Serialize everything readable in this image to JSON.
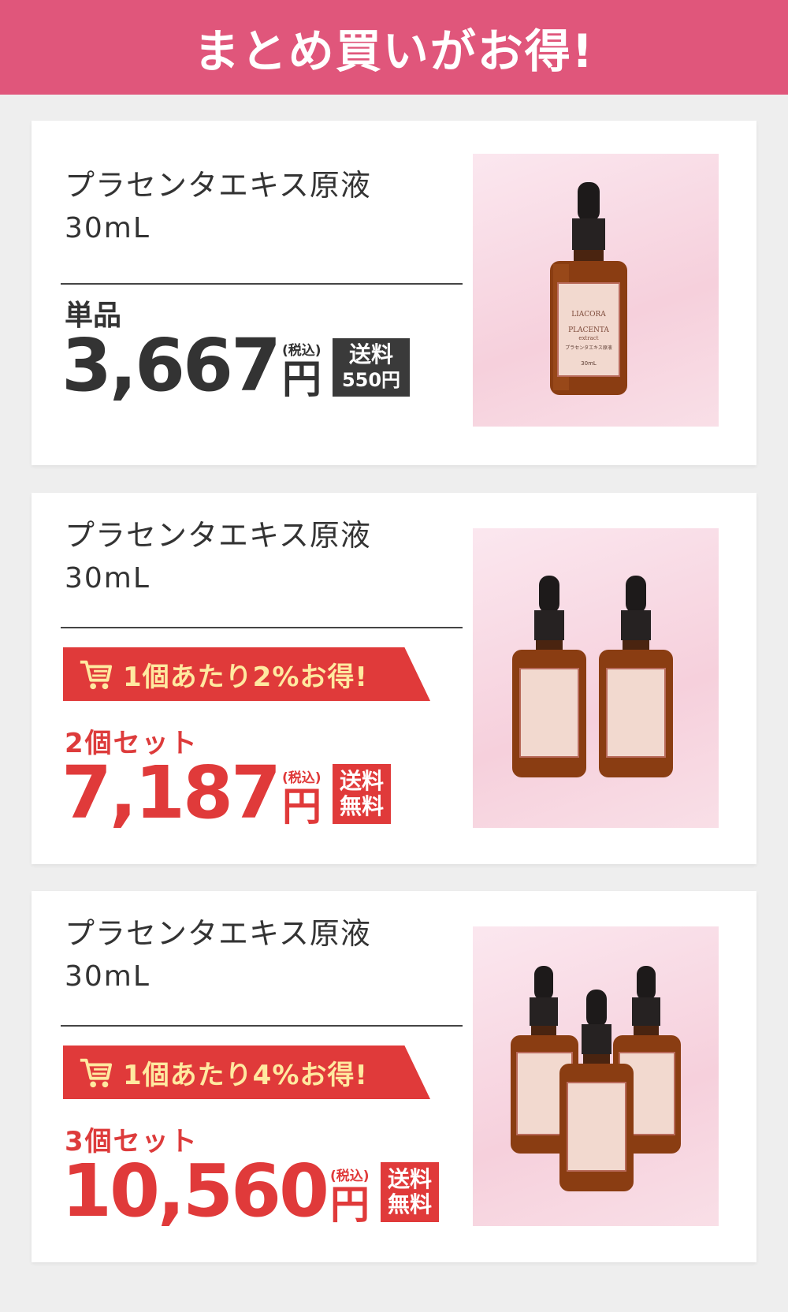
{
  "header": {
    "title": "まとめ買いがお得!"
  },
  "products": [
    {
      "name": "プラセンタエキス原液",
      "volume": "30mL",
      "label": "単品",
      "price": "3,667",
      "tax": "(税込)",
      "yen": "円",
      "shipping_line1": "送料",
      "shipping_line2": "550円"
    },
    {
      "name": "プラセンタエキス原液",
      "volume": "30mL",
      "ribbon": "1個あたり2%お得!",
      "label": "2個セット",
      "price": "7,187",
      "tax": "(税込)",
      "yen": "円",
      "shipping_line1": "送料",
      "shipping_line2": "無料"
    },
    {
      "name": "プラセンタエキス原液",
      "volume": "30mL",
      "ribbon": "1個あたり4%お得!",
      "label": "3個セット",
      "price": "10,560",
      "tax": "(税込)",
      "yen": "円",
      "shipping_line1": "送料",
      "shipping_line2": "無料"
    }
  ],
  "bottle_label": {
    "brand": "LIACORA",
    "product": "PLACENTA",
    "sub": "extract",
    "jp": "プラセンタエキス原液",
    "vol": "30mL"
  },
  "colors": {
    "header": "#e0567b",
    "accent_red": "#e03a3a",
    "ribbon_text": "#ffe9a0",
    "dark": "#333333"
  },
  "icons": [
    "shopping-cart-icon"
  ]
}
